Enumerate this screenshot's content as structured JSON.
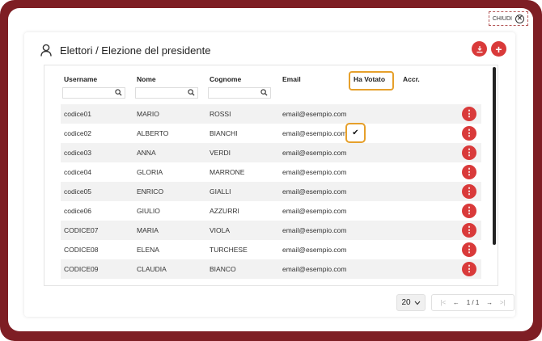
{
  "close": {
    "label": "CHIUDI"
  },
  "header": {
    "title": "Elettori / Elezione del presidente"
  },
  "columns": {
    "username": "Username",
    "nome": "Nome",
    "cognome": "Cognome",
    "email": "Email",
    "ha_votato": "Ha Votato",
    "accr": "Accr."
  },
  "rows": [
    {
      "username": "codice01",
      "nome": "MARIO",
      "cognome": "ROSSI",
      "email": "email@esempio.com",
      "ha_votato": ""
    },
    {
      "username": "codice02",
      "nome": "ALBERTO",
      "cognome": "BIANCHI",
      "email": "email@esempio.com",
      "ha_votato": "✔"
    },
    {
      "username": "codice03",
      "nome": "ANNA",
      "cognome": "VERDI",
      "email": "email@esempio.com",
      "ha_votato": ""
    },
    {
      "username": "codice04",
      "nome": "GLORIA",
      "cognome": "MARRONE",
      "email": "email@esempio.com",
      "ha_votato": ""
    },
    {
      "username": "codice05",
      "nome": "ENRICO",
      "cognome": "GIALLI",
      "email": "email@esempio.com",
      "ha_votato": ""
    },
    {
      "username": "codice06",
      "nome": "GIULIO",
      "cognome": "AZZURRI",
      "email": "email@esempio.com",
      "ha_votato": ""
    },
    {
      "username": "CODICE07",
      "nome": "MARIA",
      "cognome": "VIOLA",
      "email": "email@esempio.com",
      "ha_votato": ""
    },
    {
      "username": "CODICE08",
      "nome": "ELENA",
      "cognome": "TURCHESE",
      "email": "email@esempio.com",
      "ha_votato": ""
    },
    {
      "username": "CODICE09",
      "nome": "CLAUDIA",
      "cognome": "BIANCO",
      "email": "email@esempio.com",
      "ha_votato": ""
    }
  ],
  "pagination": {
    "page_size": "20",
    "page_info": "1 / 1"
  },
  "colors": {
    "accent": "#d93a3a",
    "frame": "#7e1e24",
    "highlight": "#e6a02b"
  },
  "icons": {
    "close": "close-circle-icon",
    "user": "user-icon",
    "download": "download-icon",
    "add": "plus-icon",
    "search": "search-icon",
    "row_menu": "more-vertical-icon",
    "check": "check-icon"
  }
}
